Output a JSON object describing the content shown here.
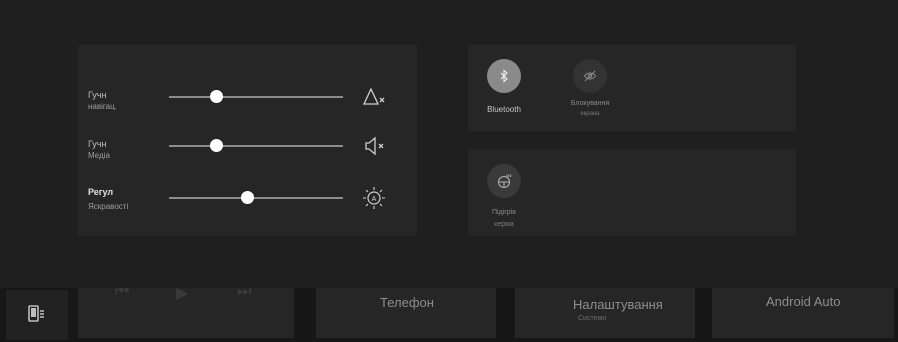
{
  "sliders": [
    {
      "label_line1": "Гучн",
      "label_line2": "навігац.",
      "value": 0.27,
      "icon": "navigation-mute-icon"
    },
    {
      "label_line1": "Гучн",
      "label_line2": "Медіа",
      "value": 0.27,
      "icon": "speaker-mute-icon"
    },
    {
      "label_line1": "Регул",
      "label_line2": "Яскравості",
      "value": 0.45,
      "icon": "brightness-auto-icon"
    }
  ],
  "toggles": {
    "bluetooth": {
      "label": "Bluetooth",
      "state": "on"
    },
    "screen_lock": {
      "label": "Блокування",
      "sublabel": "екрана",
      "state": "off"
    },
    "steering_heat": {
      "label": "Підігрів",
      "sublabel": "керма",
      "state": "off"
    }
  },
  "dock": {
    "phone_label": "Телефон",
    "settings_label": "Налаштування",
    "settings_sub": "Системи",
    "android_auto_label": "Android Auto"
  },
  "colors": {
    "thumb": "#ffffff",
    "track": "#8c8c8c",
    "toggle_on": "#8a8a8a",
    "panel": "#262626"
  }
}
